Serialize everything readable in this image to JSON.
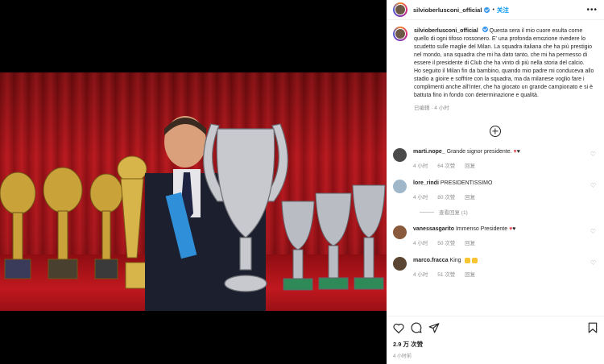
{
  "post": {
    "username": "silvioberlusconi_official",
    "follow_label": "关注",
    "caption_text": "Questa sera il mio cuore esulta come quello di ogni tifoso rossonero. E' una profonda emozione rivedere lo scudetto sulle maglie del Milan. La squadra italiana che ha più prestigio nel mondo, una squadra che mi ha dato tanto, che mi ha permesso di essere il presidente di Club che ha vinto di più nella storia del calcio.",
    "caption_text_2": "Ho seguito il Milan fin da bambino, quando mio padre mi conduceva allo stadio a gioire e soffrire con la squadra, ma da milanese voglio fare i complimenti anche all'Inter, che ha giocato un grande campionato e si è battuta fino in fondo con determinazione e qualità.",
    "caption_meta": "已编辑 · 4 小时",
    "likes": "2.9 万 次赞",
    "age": "4 小时前"
  },
  "comments": [
    {
      "user": "marti.nope_",
      "text": "Grande signor presidente.",
      "time": "4 小时",
      "likes": "64 次赞",
      "reply": "回复",
      "avatar_color": "#4a4a4a"
    },
    {
      "user": "lore_rindi",
      "text": "PRESIDENTISSIMO",
      "time": "4 小时",
      "likes": "80 次赞",
      "reply": "回复",
      "avatar_color": "#9fb7c9"
    },
    {
      "user": "vanessasgarito",
      "text": "Immenso Presidente",
      "time": "4 小时",
      "likes": "50 次赞",
      "reply": "回复",
      "avatar_color": "#8a5a3c"
    },
    {
      "user": "marco.fracca",
      "text": "King",
      "time": "4 小时",
      "likes": "51 次赞",
      "reply": "回复",
      "avatar_color": "#5a4632"
    }
  ],
  "view_replies": "查看回复 (1)",
  "icons": [
    "more-icon",
    "add-comment-icon",
    "heart-icon",
    "comment-icon",
    "share-icon",
    "bookmark-icon"
  ],
  "colors": {
    "link": "#0095f6",
    "verified": "#3897f0",
    "heart": "#ed4956"
  }
}
